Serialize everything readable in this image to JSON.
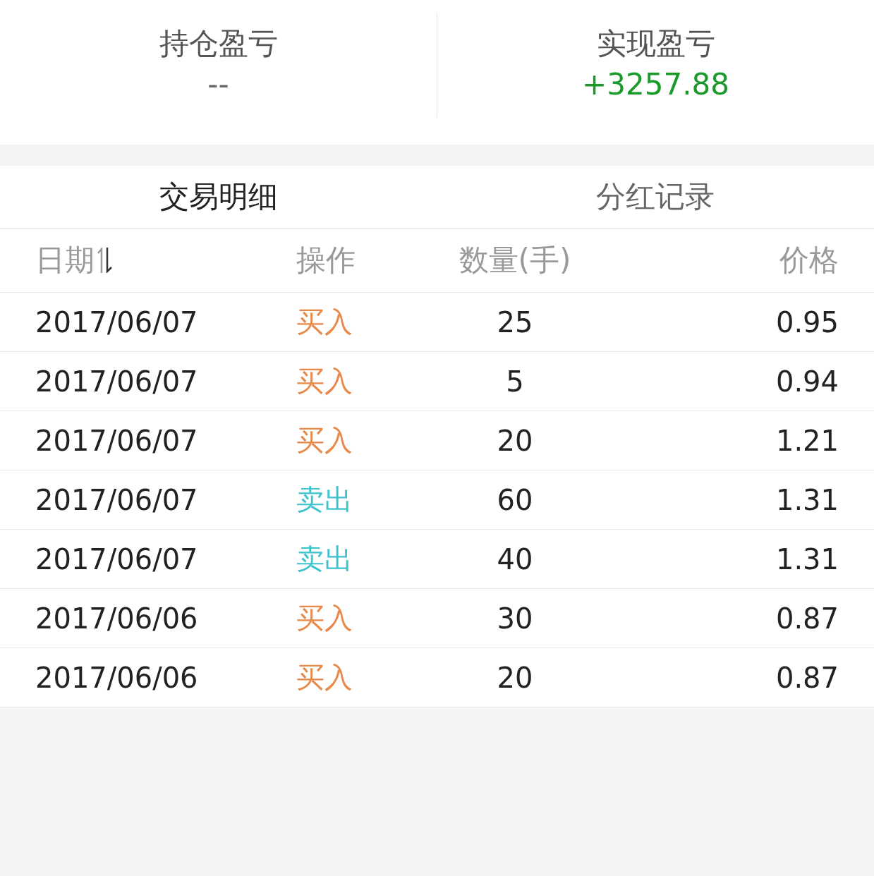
{
  "summary": [
    {
      "label": "持仓盈亏",
      "value": "--",
      "color": "#666666"
    },
    {
      "label": "实现盈亏",
      "value": "+3257.88",
      "color": "#1a9a2a"
    }
  ],
  "tabs": [
    {
      "label": "交易明细",
      "selected": true
    },
    {
      "label": "分红记录",
      "selected": false
    }
  ],
  "table": {
    "columns": [
      {
        "label": "日期",
        "sort_descending": true
      },
      {
        "label": "操作"
      },
      {
        "label": "数量(手)"
      },
      {
        "label": "价格"
      }
    ],
    "rows": [
      {
        "date": "2017/06/07",
        "action": "买入",
        "kind": "buy",
        "quantity": "25",
        "price": "0.95"
      },
      {
        "date": "2017/06/07",
        "action": "买入",
        "kind": "buy",
        "quantity": "5",
        "price": "0.94"
      },
      {
        "date": "2017/06/07",
        "action": "买入",
        "kind": "buy",
        "quantity": "20",
        "price": "1.21"
      },
      {
        "date": "2017/06/07",
        "action": "卖出",
        "kind": "sell",
        "quantity": "60",
        "price": "1.31"
      },
      {
        "date": "2017/06/07",
        "action": "卖出",
        "kind": "sell",
        "quantity": "40",
        "price": "1.31"
      },
      {
        "date": "2017/06/06",
        "action": "买入",
        "kind": "buy",
        "quantity": "30",
        "price": "0.87"
      },
      {
        "date": "2017/06/06",
        "action": "买入",
        "kind": "buy",
        "quantity": "20",
        "price": "0.87"
      }
    ]
  }
}
